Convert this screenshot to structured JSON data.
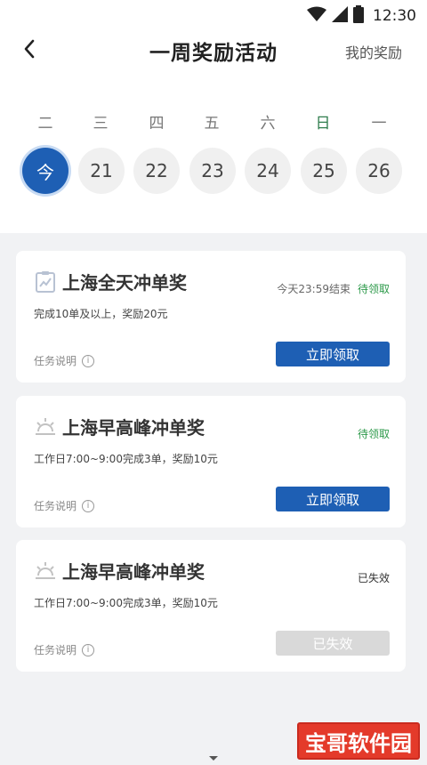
{
  "status_bar": {
    "time": "12:30"
  },
  "header": {
    "title": "一周奖励活动",
    "my_reward": "我的奖励"
  },
  "calendar": {
    "weekdays": [
      "二",
      "三",
      "四",
      "五",
      "六",
      "日",
      "一"
    ],
    "days": [
      "今",
      "21",
      "22",
      "23",
      "24",
      "25",
      "26"
    ]
  },
  "cards": [
    {
      "title": "上海全天冲单奖",
      "desc": "完成10单及以上，奖励20元",
      "deadline": "今天23:59结束",
      "status": "待领取",
      "note": "任务说明",
      "button": "立即领取"
    },
    {
      "title": "上海早高峰冲单奖",
      "desc": "工作日7:00~9:00完成3单，奖励10元",
      "status": "待领取",
      "note": "任务说明",
      "button": "立即领取"
    },
    {
      "title": "上海早高峰冲单奖",
      "desc": "工作日7:00~9:00完成3单，奖励10元",
      "status": "已失效",
      "note": "任务说明",
      "button": "已失效"
    }
  ],
  "info_glyph": "i",
  "watermark": "宝哥软件园",
  "colors": {
    "primary": "#1e5fb4",
    "green": "#2e9a4b",
    "disabled": "#d9d9d9"
  }
}
